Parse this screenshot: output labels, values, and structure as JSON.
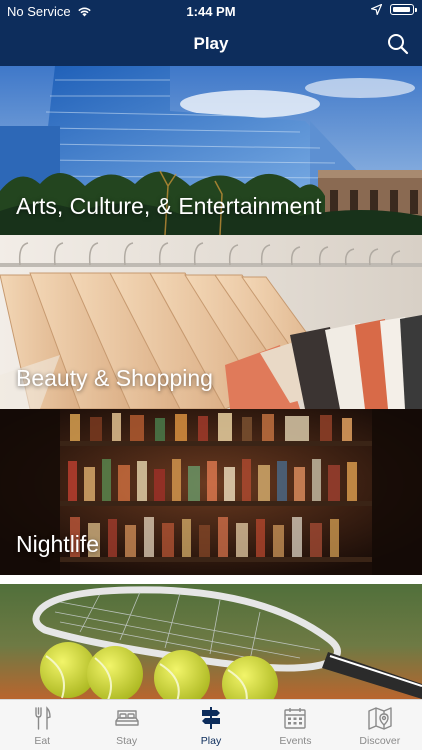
{
  "status_bar": {
    "carrier": "No Service",
    "time": "1:44 PM"
  },
  "header": {
    "title": "Play"
  },
  "categories": [
    {
      "label": "Arts, Culture, & Entertainment"
    },
    {
      "label": "Beauty & Shopping"
    },
    {
      "label": "Nightlife"
    },
    {
      "label": ""
    }
  ],
  "tabs": [
    {
      "label": "Eat",
      "icon": "fork-knife-icon",
      "active": false
    },
    {
      "label": "Stay",
      "icon": "bed-icon",
      "active": false
    },
    {
      "label": "Play",
      "icon": "signpost-icon",
      "active": true
    },
    {
      "label": "Events",
      "icon": "calendar-icon",
      "active": false
    },
    {
      "label": "Discover",
      "icon": "map-pin-icon",
      "active": false
    }
  ],
  "colors": {
    "header_bg": "#0d2d5c",
    "active_tab": "#0d2d5c",
    "inactive_tab": "#8a8a8a"
  }
}
